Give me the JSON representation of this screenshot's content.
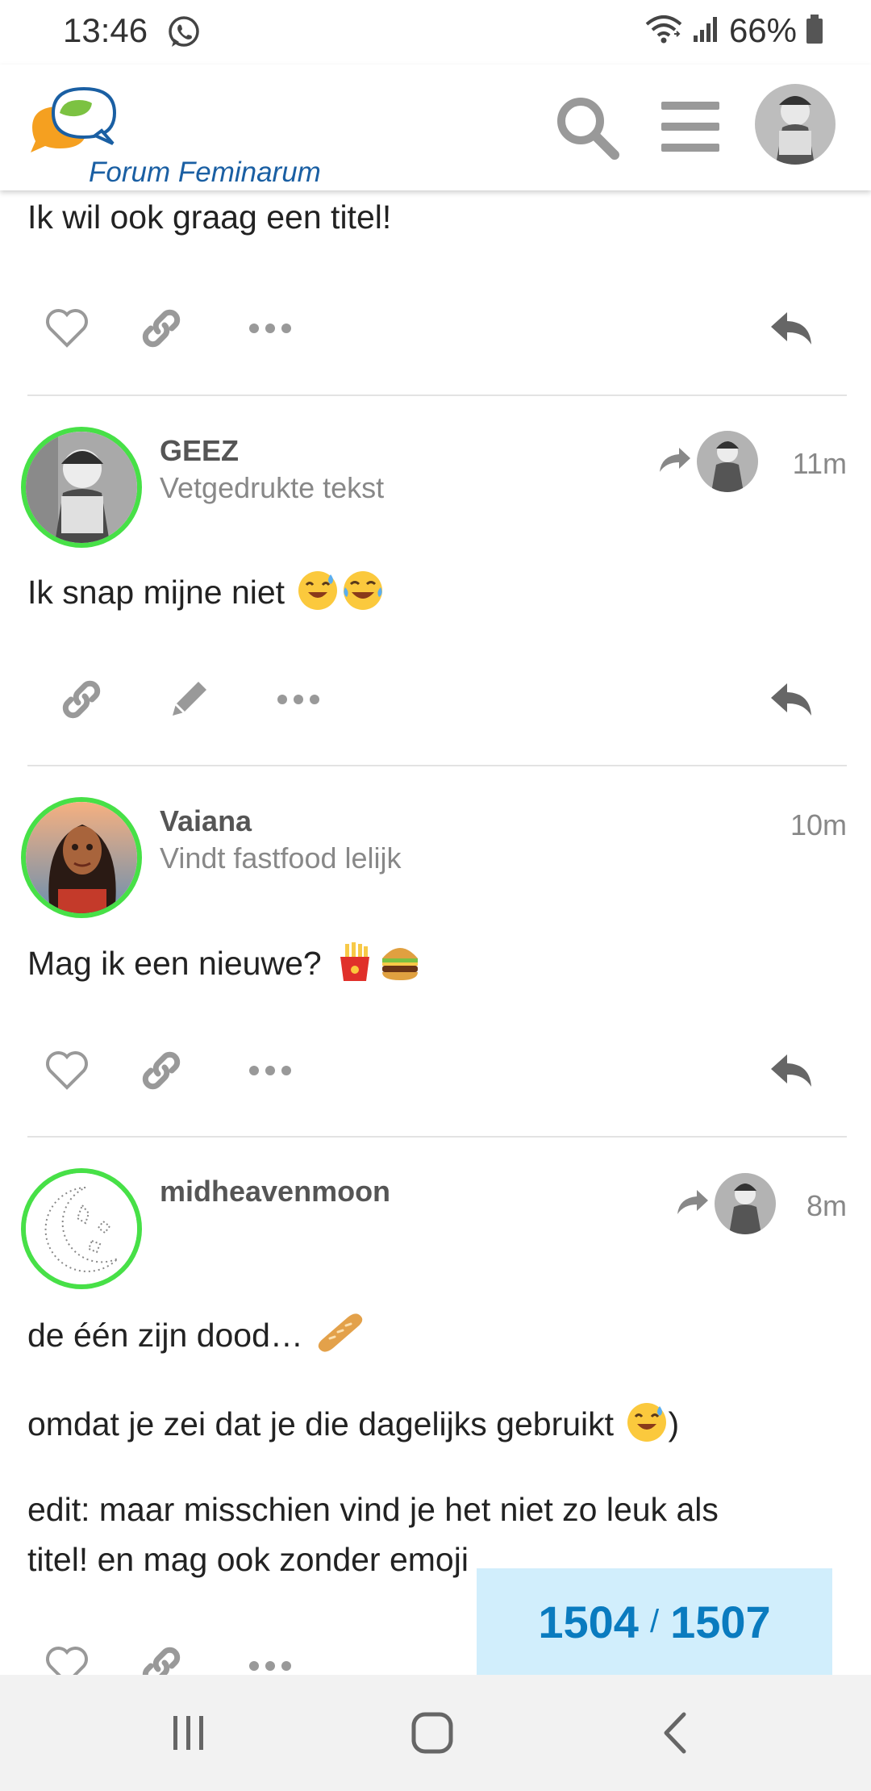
{
  "status_bar": {
    "time": "13:46",
    "battery": "66%",
    "icons": [
      "whatsapp-icon",
      "wifi-icon",
      "signal-icon",
      "battery-icon"
    ]
  },
  "header": {
    "logo_text": "Forum Feminarum",
    "icons": [
      "search-icon",
      "hamburger-menu-icon",
      "user-avatar"
    ]
  },
  "posts": [
    {
      "paragraphs": [
        "Ik wil ook graag een titel!"
      ],
      "actions": [
        "heart-icon",
        "link-icon",
        "more-icon",
        "reply-icon"
      ]
    },
    {
      "username": "GEEZ",
      "user_title": "Vetgedrukte tekst",
      "time": "11m",
      "paragraphs": [
        "Ik snap mijne niet"
      ],
      "emojis": [
        "grinning-sweat-emoji",
        "tears-of-joy-emoji"
      ],
      "actions": [
        "link-icon",
        "pencil-icon",
        "more-icon",
        "reply-icon"
      ]
    },
    {
      "username": "Vaiana",
      "user_title": "Vindt fastfood lelijk",
      "time": "10m",
      "paragraphs": [
        "Mag ik een nieuwe?"
      ],
      "emojis": [
        "fries-emoji",
        "burger-emoji"
      ],
      "actions": [
        "heart-icon",
        "link-icon",
        "more-icon",
        "reply-icon"
      ]
    },
    {
      "username": "midheavenmoon",
      "time": "8m",
      "paragraphs": [
        "de één zijn dood…",
        "omdat je zei dat je die dagelijks gebruikt",
        ")",
        "edit: maar misschien vind je het niet zo leuk als",
        "titel! en mag ook zonder emoji"
      ],
      "emojis": [
        "baguette-emoji",
        "grinning-sweat-emoji"
      ],
      "actions": [
        "heart-icon",
        "link-icon",
        "more-icon"
      ]
    }
  ],
  "progress": {
    "current": "1504",
    "separator": "/",
    "total": "1507"
  },
  "nav_bar": {
    "icons": [
      "recent-apps-icon",
      "home-icon",
      "back-icon"
    ]
  },
  "colors": {
    "accent": "#0a7bbf",
    "progress_bg": "#d1eefc",
    "avatar_ring": "#47e047",
    "logo_blue": "#1a5fa3"
  }
}
